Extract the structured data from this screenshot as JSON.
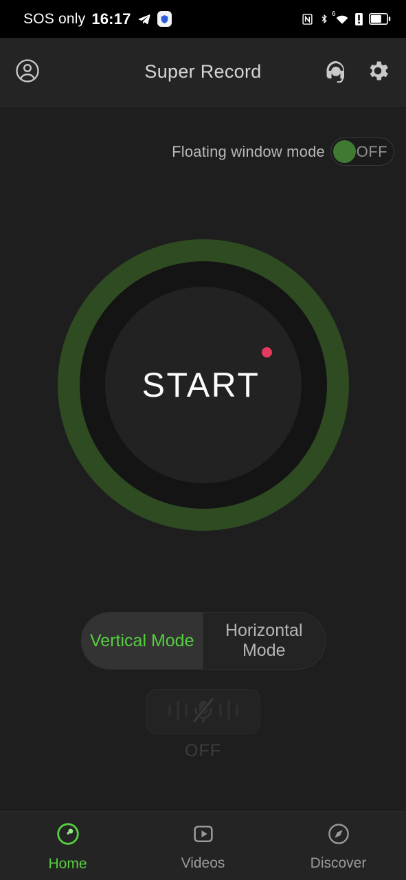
{
  "statusbar": {
    "carrier": "SOS only",
    "time": "16:17",
    "left_icons": [
      "telegram-icon",
      "shield-app-icon"
    ],
    "right_icons": [
      "nfc-icon",
      "bluetooth-icon",
      "wifi-6-icon",
      "alert-icon",
      "battery-icon"
    ],
    "wifi_generation": "6",
    "battery_level_percent": 60
  },
  "header": {
    "title": "Super Record",
    "account_icon": "account-circle-icon",
    "support_icon": "headset-icon",
    "settings_icon": "gear-icon"
  },
  "floating_window": {
    "label": "Floating window mode",
    "state": "OFF",
    "enabled": false
  },
  "record": {
    "button_label": "START",
    "rec_dot_color": "#e53a60",
    "ring_color": "#55cf3f",
    "ring_track_color": "#2e4b22"
  },
  "orientation": {
    "options": [
      {
        "label": "Vertical Mode",
        "active": true
      },
      {
        "label": "Horizontal\nMode",
        "line1": "Horizontal",
        "line2": "Mode",
        "active": false
      }
    ]
  },
  "microphone": {
    "icon": "microphone-muted-icon",
    "state": "OFF",
    "enabled": false
  },
  "nav": {
    "items": [
      {
        "label": "Home",
        "icon": "record-circle-icon",
        "active": true
      },
      {
        "label": "Videos",
        "icon": "play-box-icon",
        "active": false
      },
      {
        "label": "Discover",
        "icon": "compass-icon",
        "active": false
      }
    ],
    "active_color": "#55cf3f"
  }
}
